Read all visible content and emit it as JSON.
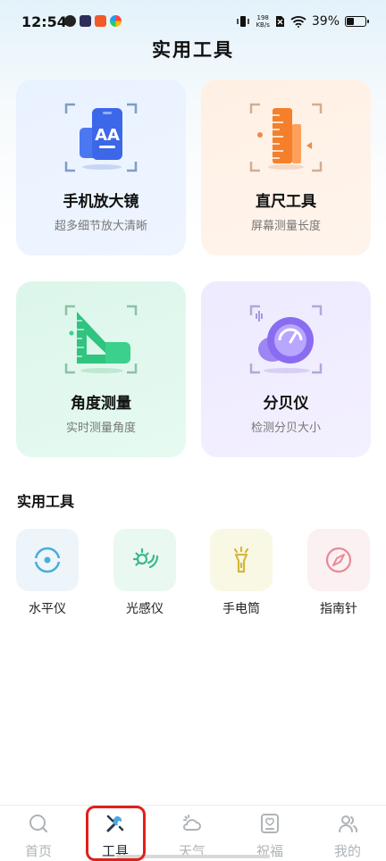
{
  "status_bar": {
    "time": "12:54",
    "net_speed_value": "198",
    "net_speed_unit": "KB/s",
    "battery": "39%",
    "battery_level": 0.39,
    "app_icons": [
      "app-icon-1",
      "app-icon-2",
      "app-icon-3",
      "app-icon-4"
    ]
  },
  "header": {
    "title": "实用工具"
  },
  "cards": [
    {
      "title": "手机放大镜",
      "subtitle": "超多细节放大清晰",
      "icon": "magnifier-phone-icon"
    },
    {
      "title": "直尺工具",
      "subtitle": "屏幕测量长度",
      "icon": "ruler-icon"
    },
    {
      "title": "角度测量",
      "subtitle": "实时测量角度",
      "icon": "protractor-icon"
    },
    {
      "title": "分贝仪",
      "subtitle": "检测分贝大小",
      "icon": "decibel-meter-icon"
    }
  ],
  "tools_section": {
    "title": "实用工具",
    "items": [
      {
        "label": "水平仪",
        "icon": "level-icon"
      },
      {
        "label": "光感仪",
        "icon": "light-sensor-icon"
      },
      {
        "label": "手电筒",
        "icon": "flashlight-icon"
      },
      {
        "label": "指南针",
        "icon": "compass-icon"
      }
    ]
  },
  "nav": {
    "items": [
      {
        "label": "首页",
        "icon": "home-search-icon"
      },
      {
        "label": "工具",
        "icon": "tools-icon"
      },
      {
        "label": "天气",
        "icon": "weather-icon"
      },
      {
        "label": "祝福",
        "icon": "greeting-icon"
      },
      {
        "label": "我的",
        "icon": "profile-icon"
      }
    ],
    "active": "工具"
  },
  "colors": {
    "accent_highlight": "#e0201c",
    "magnifier_blue": "#3b6df0",
    "ruler_orange": "#f7842d",
    "angle_green": "#2fc47f",
    "decibel_purple": "#8a6cf0"
  }
}
